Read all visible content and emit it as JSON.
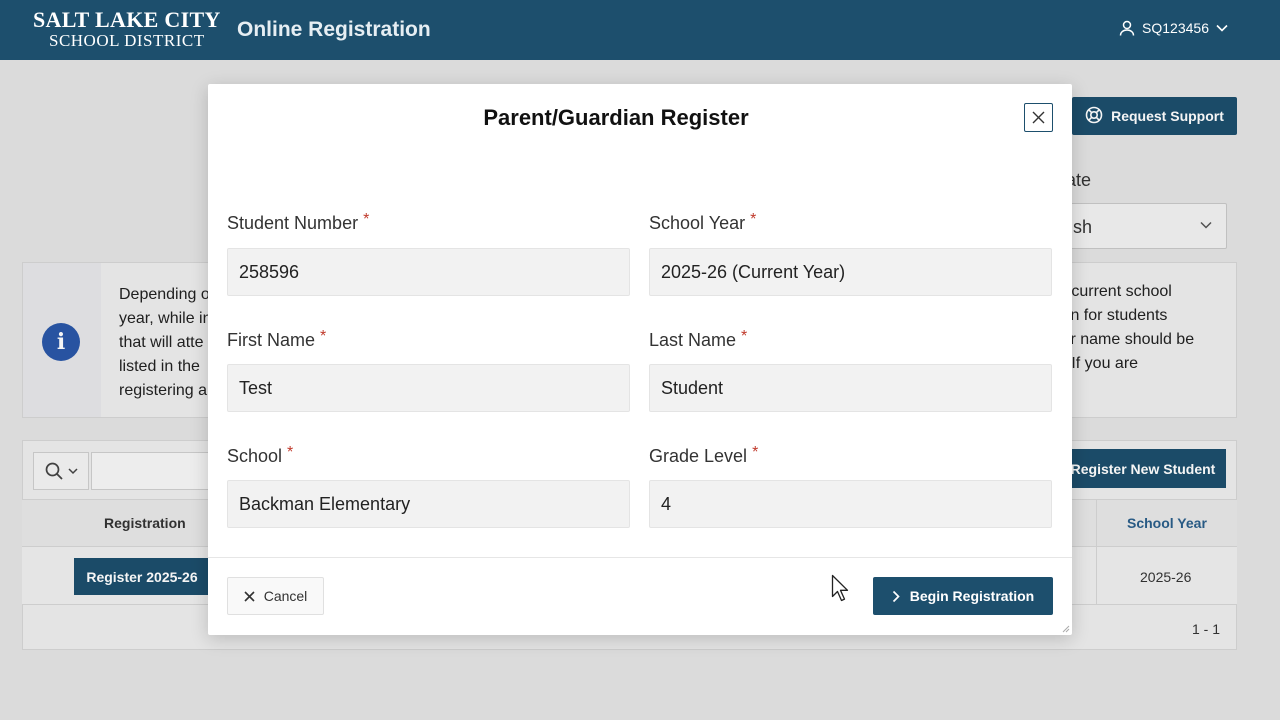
{
  "header": {
    "logo_line1": "SALT LAKE CITY",
    "logo_line2": "SCHOOL DISTRICT",
    "app_title": "Online Registration",
    "user_id": "SQ123456"
  },
  "background": {
    "support_button": "Request Support",
    "language_label_partial": "ate",
    "language_value_partial": "sh",
    "info_left": [
      "Depending o",
      "year, while in",
      "that will atte",
      "listed in the",
      "registering a"
    ],
    "info_right": [
      "e current school",
      "lan for students",
      "eir name should be",
      "t. If you are"
    ],
    "register_new_button": "Register New Student",
    "table": {
      "col_registration": "Registration",
      "col_school_year": "School Year",
      "row_button": "Register 2025-26",
      "row_school_year": "2025-26"
    },
    "pagination": "1 - 1"
  },
  "modal": {
    "title": "Parent/Guardian Register",
    "fields": {
      "student_number": {
        "label": "Student Number",
        "value": "258596"
      },
      "school_year": {
        "label": "School Year",
        "value": "2025-26 (Current Year)"
      },
      "first_name": {
        "label": "First Name",
        "value": "Test"
      },
      "last_name": {
        "label": "Last Name",
        "value": "Student"
      },
      "school": {
        "label": "School",
        "value": "Backman Elementary"
      },
      "grade_level": {
        "label": "Grade Level",
        "value": "4"
      }
    },
    "required_marker": "*",
    "cancel_label": "Cancel",
    "begin_label": "Begin Registration"
  },
  "colors": {
    "brand": "#1d4f6d",
    "required": "#c0392b",
    "info_icon": "#2a57a8"
  }
}
